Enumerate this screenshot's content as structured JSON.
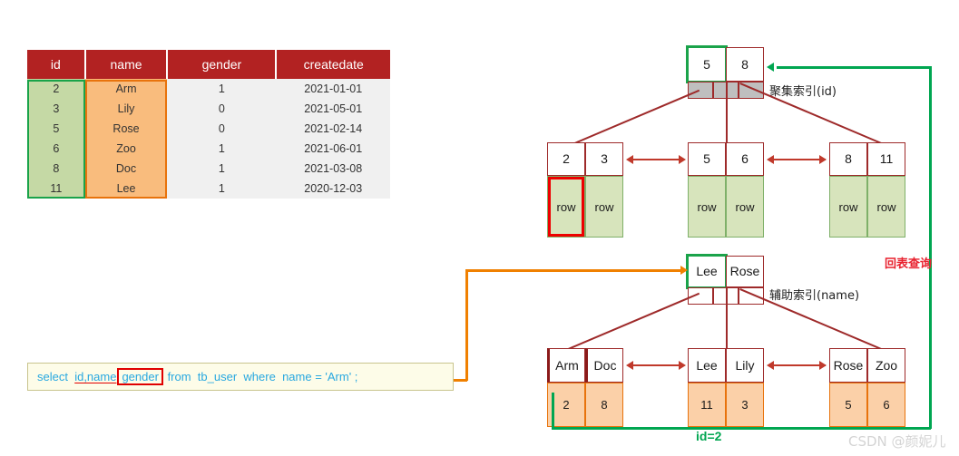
{
  "table": {
    "columns": [
      "id",
      "name",
      "gender",
      "createdate"
    ],
    "rows": [
      {
        "id": "2",
        "name": "Arm",
        "gender": "1",
        "createdate": "2021-01-01"
      },
      {
        "id": "3",
        "name": "Lily",
        "gender": "0",
        "createdate": "2021-05-01"
      },
      {
        "id": "5",
        "name": "Rose",
        "gender": "0",
        "createdate": "2021-02-14"
      },
      {
        "id": "6",
        "name": "Zoo",
        "gender": "1",
        "createdate": "2021-06-01"
      },
      {
        "id": "8",
        "name": "Doc",
        "gender": "1",
        "createdate": "2021-03-08"
      },
      {
        "id": "11",
        "name": "Lee",
        "gender": "1",
        "createdate": "2020-12-03"
      }
    ],
    "highlight_id_color": "#1aa34a",
    "highlight_name_color": "#e8730c",
    "header_color": "#b22222"
  },
  "sql": {
    "kw_select": "select",
    "underlined_cols": "id,name",
    "boxed_col": "gender",
    "after_boxed": ",",
    "kw_from": "from",
    "table_name": "tb_user",
    "kw_where": "where",
    "condition": "name = 'Arm' ;"
  },
  "clustered_index": {
    "label": "聚集索引(id)",
    "root": {
      "keys": [
        "5",
        "8"
      ],
      "selected_key": "5",
      "pointers": 3
    },
    "leaves": [
      {
        "keys": [
          "2",
          "3"
        ],
        "data": [
          "row",
          "row"
        ],
        "selected_index": 0
      },
      {
        "keys": [
          "5",
          "6"
        ],
        "data": [
          "row",
          "row"
        ],
        "selected_index": -1
      },
      {
        "keys": [
          "8",
          "11"
        ],
        "data": [
          "row",
          "row"
        ],
        "selected_index": -1
      }
    ],
    "row_cell_color": "#d7e4bc"
  },
  "secondary_index": {
    "label": "辅助索引(name)",
    "root": {
      "keys": [
        "Lee",
        "Rose"
      ],
      "selected_key": "Lee",
      "pointers": 3
    },
    "leaves": [
      {
        "keys": [
          "Arm",
          "Doc"
        ],
        "data": [
          "2",
          "8"
        ],
        "selected_index": 0
      },
      {
        "keys": [
          "Lee",
          "Lily"
        ],
        "data": [
          "11",
          "3"
        ],
        "selected_index": -1
      },
      {
        "keys": [
          "Rose",
          "Zoo"
        ],
        "data": [
          "5",
          "6"
        ],
        "selected_index": -1
      }
    ],
    "row_cell_color": "#fbd0a8"
  },
  "annotations": {
    "lookup_label": "回表查询",
    "id_equals_label": "id=2",
    "lookup_color": "#e8212e",
    "flow_color": "#00a651",
    "query_color": "#f08000"
  },
  "watermark": "CSDN @颜妮儿"
}
